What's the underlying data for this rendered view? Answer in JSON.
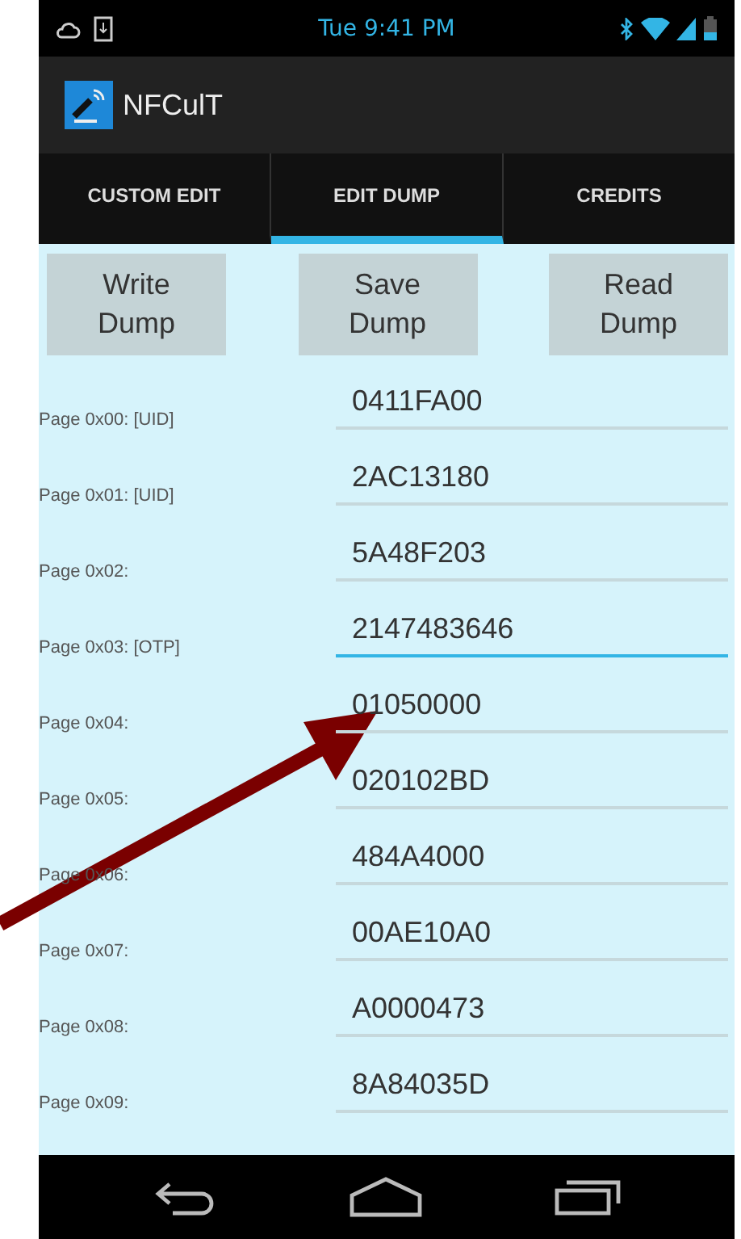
{
  "status_bar": {
    "time": "Tue 9:41 PM"
  },
  "app_bar": {
    "title": "NFCulT"
  },
  "tabs": [
    {
      "label": "CUSTOM EDIT",
      "selected": false
    },
    {
      "label": "EDIT DUMP",
      "selected": true
    },
    {
      "label": "CREDITS",
      "selected": false
    }
  ],
  "buttons": [
    "Write Dump",
    "Save Dump",
    "Read Dump"
  ],
  "pages": [
    {
      "label": "Page 0x00: [UID]",
      "value": "0411FA00",
      "focused": false
    },
    {
      "label": "Page 0x01: [UID]",
      "value": "2AC13180",
      "focused": false
    },
    {
      "label": "Page 0x02:",
      "value": "5A48F203",
      "focused": false
    },
    {
      "label": "Page 0x03: [OTP]",
      "value": "2147483646",
      "focused": true
    },
    {
      "label": "Page 0x04:",
      "value": "01050000",
      "focused": false
    },
    {
      "label": "Page 0x05:",
      "value": "020102BD",
      "focused": false
    },
    {
      "label": "Page 0x06:",
      "value": "484A4000",
      "focused": false
    },
    {
      "label": "Page 0x07:",
      "value": "00AE10A0",
      "focused": false
    },
    {
      "label": "Page 0x08:",
      "value": "A0000473",
      "focused": false
    },
    {
      "label": "Page 0x09:",
      "value": "8A84035D",
      "focused": false
    }
  ]
}
